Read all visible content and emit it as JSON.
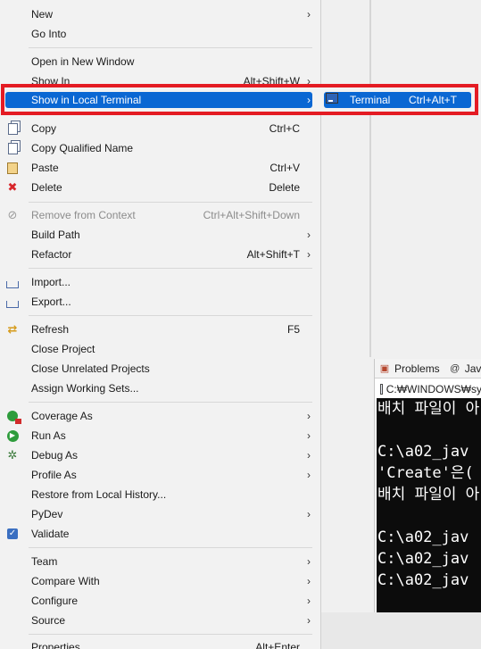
{
  "menu": {
    "items": [
      {
        "label": "New",
        "accel": "",
        "submenu": true
      },
      {
        "label": "Go Into",
        "accel": "",
        "submenu": false
      },
      {
        "label": "Open in New Window",
        "accel": "",
        "submenu": false
      },
      {
        "label": "Show In",
        "accel": "Alt+Shift+W",
        "submenu": true
      },
      {
        "label": "Show in Local Terminal",
        "accel": "",
        "submenu": true,
        "highlighted": true
      },
      {
        "label": "Copy",
        "accel": "Ctrl+C",
        "icon": "copy-icon"
      },
      {
        "label": "Copy Qualified Name",
        "accel": "",
        "icon": "copy-qualified-name-icon"
      },
      {
        "label": "Paste",
        "accel": "Ctrl+V",
        "icon": "paste-icon"
      },
      {
        "label": "Delete",
        "accel": "Delete",
        "icon": "delete-icon"
      },
      {
        "label": "Remove from Context",
        "accel": "Ctrl+Alt+Shift+Down",
        "icon": "remove-context-icon",
        "disabled": true
      },
      {
        "label": "Build Path",
        "accel": "",
        "submenu": true
      },
      {
        "label": "Refactor",
        "accel": "Alt+Shift+T",
        "submenu": true
      },
      {
        "label": "Import...",
        "accel": "",
        "icon": "import-icon"
      },
      {
        "label": "Export...",
        "accel": "",
        "icon": "export-icon"
      },
      {
        "label": "Refresh",
        "accel": "F5",
        "icon": "refresh-icon"
      },
      {
        "label": "Close Project",
        "accel": ""
      },
      {
        "label": "Close Unrelated Projects",
        "accel": ""
      },
      {
        "label": "Assign Working Sets...",
        "accel": ""
      },
      {
        "label": "Coverage As",
        "accel": "",
        "submenu": true,
        "icon": "coverage-icon"
      },
      {
        "label": "Run As",
        "accel": "",
        "submenu": true,
        "icon": "run-icon"
      },
      {
        "label": "Debug As",
        "accel": "",
        "submenu": true,
        "icon": "debug-icon"
      },
      {
        "label": "Profile As",
        "accel": "",
        "submenu": true
      },
      {
        "label": "Restore from Local History...",
        "accel": ""
      },
      {
        "label": "PyDev",
        "accel": "",
        "submenu": true
      },
      {
        "label": "Validate",
        "accel": "",
        "icon": "validate-check-icon"
      },
      {
        "label": "Team",
        "accel": "",
        "submenu": true
      },
      {
        "label": "Compare With",
        "accel": "",
        "submenu": true
      },
      {
        "label": "Configure",
        "accel": "",
        "submenu": true
      },
      {
        "label": "Source",
        "accel": "",
        "submenu": true
      },
      {
        "label": "Properties",
        "accel": "Alt+Enter"
      }
    ],
    "submenu_arrow": "›"
  },
  "submenu": {
    "label": "Terminal",
    "accel": "Ctrl+Alt+T",
    "icon": "terminal-icon"
  },
  "panel": {
    "tab_problems": "Problems",
    "tab_javadoc": "Jav",
    "console_title": "C:₩WINDOWS₩sy",
    "console_lines": [
      "배치 파일이 아",
      "",
      "C:\\a02_jav",
      "'Create'은(",
      "배치 파일이 아",
      "",
      "C:\\a02_jav",
      "C:\\a02_jav",
      "C:\\a02_jav"
    ]
  },
  "colors": {
    "highlight": "#0a67d3",
    "annotation": "#e41b23",
    "menu_bg": "#f2f2f2"
  }
}
